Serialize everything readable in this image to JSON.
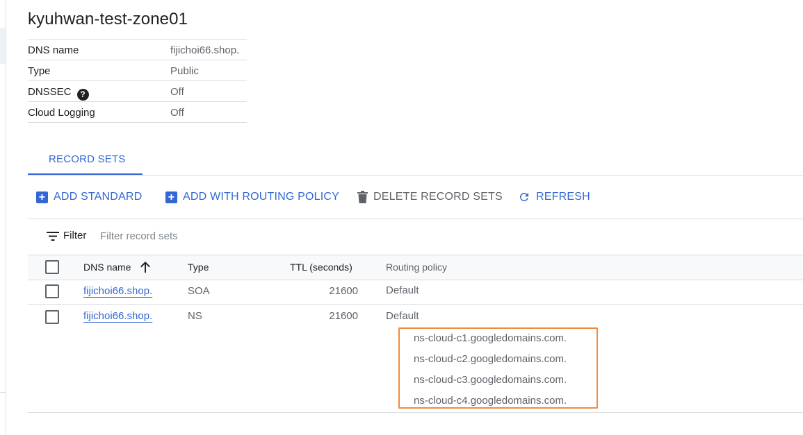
{
  "zone": {
    "title": "kyuhwan-test-zone01"
  },
  "details": [
    {
      "label": "DNS name",
      "value": "fijichoi66.shop."
    },
    {
      "label": "Type",
      "value": "Public"
    },
    {
      "label": "DNSSEC",
      "value": "Off"
    },
    {
      "label": "Cloud Logging",
      "value": "Off"
    }
  ],
  "tabs": [
    {
      "label": "RECORD SETS",
      "active": true
    }
  ],
  "toolbar": {
    "add_standard": "ADD STANDARD",
    "add_routing": "ADD WITH ROUTING POLICY",
    "delete": "DELETE RECORD SETS",
    "refresh": "REFRESH"
  },
  "filter": {
    "label": "Filter",
    "placeholder": "Filter record sets"
  },
  "table": {
    "columns": [
      "DNS name",
      "Type",
      "TTL (seconds)",
      "Routing policy"
    ],
    "rows": [
      {
        "dns_name": "fijichoi66.shop.",
        "type": "SOA",
        "ttl": "21600",
        "routing": "Default",
        "values": []
      },
      {
        "dns_name": "fijichoi66.shop.",
        "type": "NS",
        "ttl": "21600",
        "routing": "Default",
        "values": [
          "ns-cloud-c1.googledomains.com.",
          "ns-cloud-c2.googledomains.com.",
          "ns-cloud-c3.googledomains.com.",
          "ns-cloud-c4.googledomains.com."
        ]
      }
    ]
  },
  "colors": {
    "accent": "#3367d6",
    "highlight": "#f28a3c",
    "muted": "#5f6368"
  }
}
